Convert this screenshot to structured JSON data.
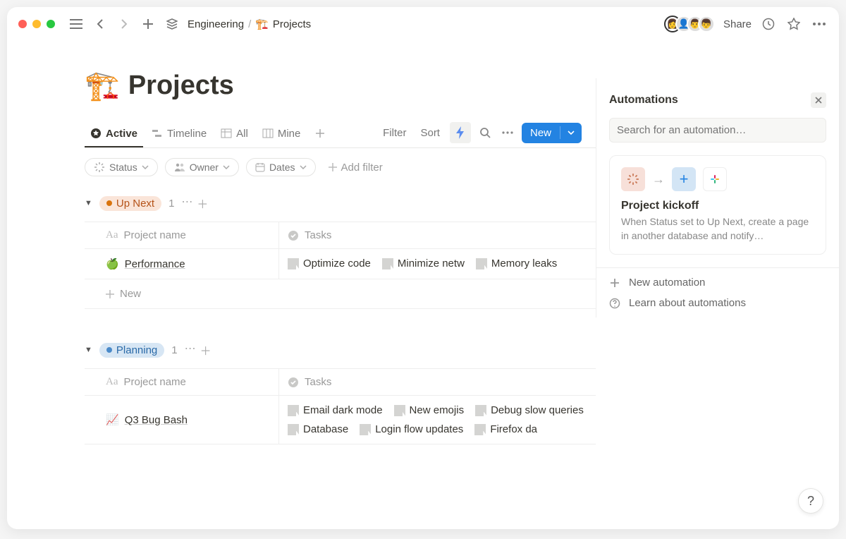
{
  "topbar": {
    "breadcrumb_parent": "Engineering",
    "breadcrumb_sep": "/",
    "breadcrumb_current": "Projects",
    "crane_emoji": "🏗️",
    "share_label": "Share"
  },
  "page": {
    "emoji": "🏗️",
    "title": "Projects"
  },
  "tabs": {
    "active": "Active",
    "timeline": "Timeline",
    "all": "All",
    "mine": "Mine"
  },
  "toolbar": {
    "filter": "Filter",
    "sort": "Sort",
    "new": "New"
  },
  "filters": {
    "status": "Status",
    "owner": "Owner",
    "dates": "Dates",
    "add_filter": "Add filter"
  },
  "columns": {
    "name": "Project name",
    "tasks": "Tasks"
  },
  "groups": [
    {
      "label": "Up Next",
      "color": "orange",
      "dot": "#d9730d",
      "count": "1",
      "rows": [
        {
          "emoji": "🍏",
          "name": "Performance",
          "tasks": [
            "Optimize code",
            "Minimize netw",
            "Memory leaks"
          ]
        }
      ]
    },
    {
      "label": "Planning",
      "color": "blue",
      "dot": "#4a8ac9",
      "count": "1",
      "rows": [
        {
          "emoji": "📈",
          "name": "Q3 Bug Bash",
          "tasks": [
            "Email dark mode",
            "New emojis",
            "Debug slow queries",
            "Database",
            "Login flow updates",
            "Firefox da"
          ]
        }
      ]
    }
  ],
  "new_row": "New",
  "panel": {
    "title": "Automations",
    "search_placeholder": "Search for an automation…",
    "card": {
      "title": "Project kickoff",
      "desc": "When Status set to Up Next, create a page in another database and notify…"
    },
    "new_automation": "New automation",
    "learn": "Learn about automations"
  },
  "help": "?"
}
